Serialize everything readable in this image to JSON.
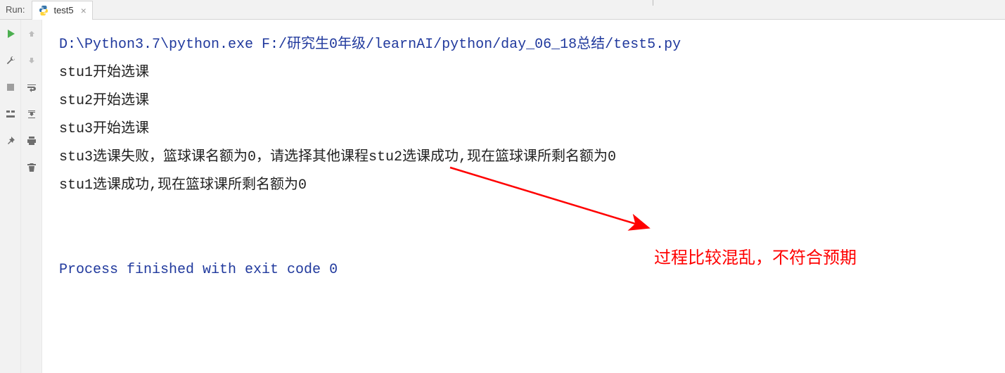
{
  "header": {
    "run_label": "Run:",
    "tab": {
      "filename": "test5",
      "close": "×"
    }
  },
  "console": {
    "command_line": "D:\\Python3.7\\python.exe F:/研究生0年级/learnAI/python/day_06_18总结/test5.py",
    "lines": [
      "stu1开始选课",
      "stu2开始选课",
      "stu3开始选课",
      "stu3选课失败，篮球课名额为0，请选择其他课程stu2选课成功,现在篮球课所剩名额为0",
      "stu1选课成功,现在篮球课所剩名额为0"
    ],
    "exit_message": "Process finished with exit code 0"
  },
  "annotation": {
    "text": "过程比较混乱，不符合预期"
  }
}
